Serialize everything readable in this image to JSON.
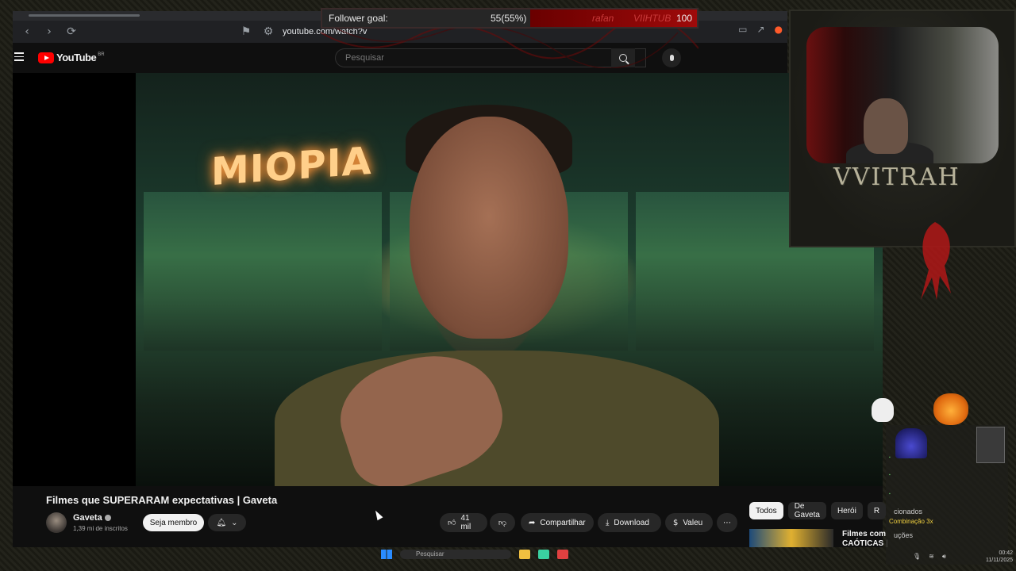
{
  "browser": {
    "url": "youtube.com/watch?v"
  },
  "youtube": {
    "brand": "YouTube",
    "country": "BR",
    "search_placeholder": "Pesquisar"
  },
  "video": {
    "sign_text": "MIOPIA",
    "title": "Filmes que SUPERARAM expectativas | Gaveta",
    "channel": "Gaveta",
    "subscribers": "1,39 mi de inscritos",
    "join_label": "Seja membro",
    "likes": "41 mil",
    "share_label": "Compartilhar",
    "download_label": "Download",
    "thanks_label": "Valeu"
  },
  "sidebar": {
    "chips": [
      "Todos",
      "De Gaveta",
      "Herói",
      "R"
    ],
    "suggestion_title": "Filmes com CAÓTICAS |"
  },
  "overlay": {
    "goal_label": "Follower goal:",
    "goal_value": "55(55%)",
    "goal_progress": 0.55,
    "goal_user1": "rafan",
    "goal_user2": "VIIHTUB",
    "goal_target": "100",
    "streamer_name": "VVITRAH",
    "chat_menu1": "cionados",
    "chat_highlight": "Combinação 3x",
    "chat_menu2": "uções"
  },
  "taskbar": {
    "search_placeholder": "Pesquisar",
    "time": "00:42",
    "date": "11/11/2025"
  },
  "colors": {
    "youtube_red": "#ff0000",
    "goal_red": "#9e0a0a",
    "dark_bg": "#0f0f0f"
  }
}
